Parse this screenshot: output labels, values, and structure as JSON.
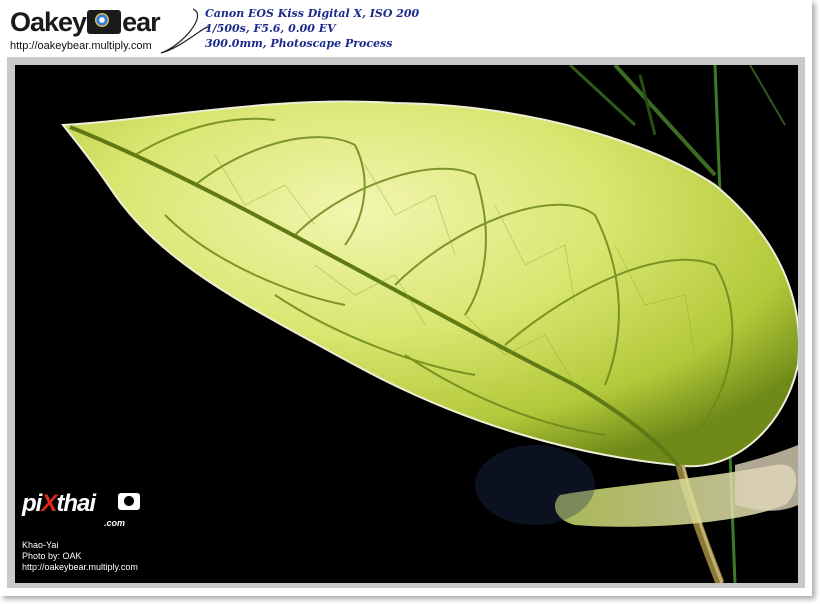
{
  "header": {
    "logo_left": "Oakey",
    "logo_right": "ear",
    "logo_url": "http://oakeybear.multiply.com",
    "exif_lines": [
      "Canon EOS Kiss Digital X, ISO 200",
      "1/500s, F5.6, 0.00 EV",
      "300.0mm, Photoscape Process"
    ]
  },
  "watermark": {
    "logo_pre": "pi",
    "logo_x": "X",
    "logo_post": "thai",
    "logo_domain": ".com",
    "lines": [
      "Khao-Yai",
      "Photo by: OAK",
      "http://oakeybear.multiply.com"
    ]
  },
  "colors": {
    "exif_text": "#1a2a8a",
    "leaf_light": "#f0f5a0",
    "leaf_mid": "#c8db4a",
    "leaf_dark": "#7f9a20",
    "background": "#000000",
    "pixthai_x": "#e0251b"
  }
}
